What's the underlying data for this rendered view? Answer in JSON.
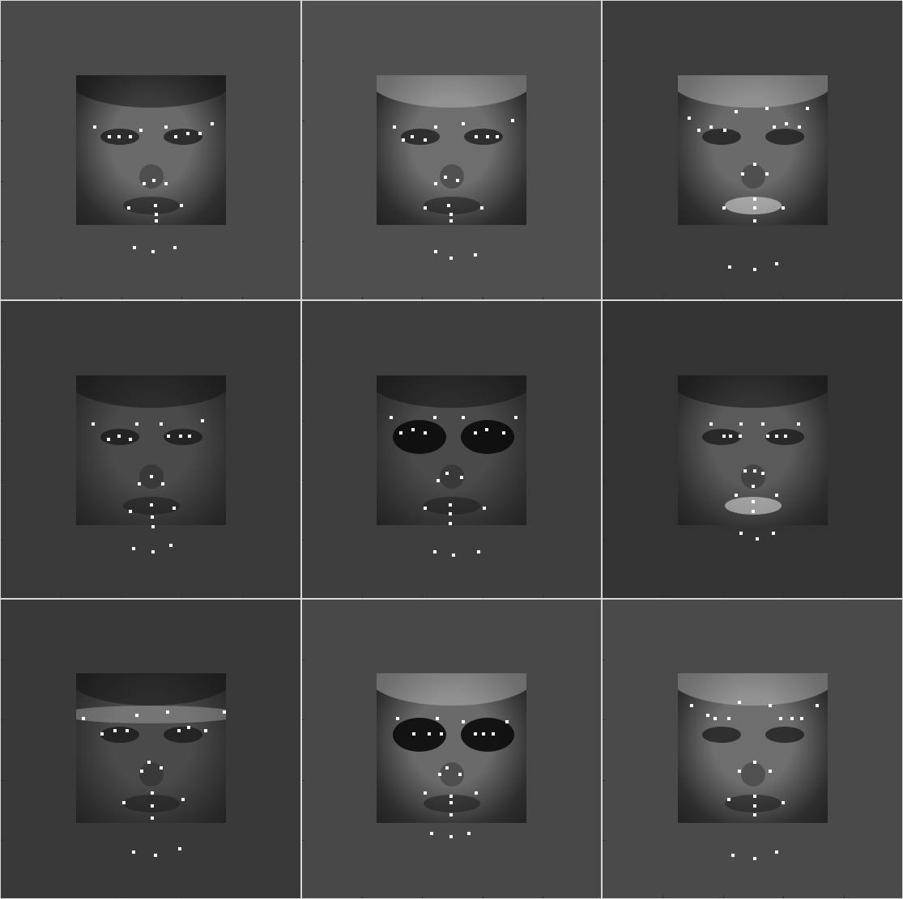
{
  "grid": {
    "rows": 3,
    "cols": 3,
    "panels": [
      {
        "background": "#4a4a4a",
        "subject": "man-short-hair",
        "face_tone": "#6a6a6a",
        "eyewear": "none",
        "landmark_count": 20
      },
      {
        "background": "#4f4f4f",
        "subject": "woman-blonde",
        "face_tone": "#6e6e6e",
        "eyewear": "none",
        "landmark_count": 20
      },
      {
        "background": "#3c3c3c",
        "subject": "woman-blonde-smiling",
        "face_tone": "#6a6a6a",
        "eyewear": "none",
        "landmark_count": 20
      },
      {
        "background": "#3a3a3a",
        "subject": "man-dark-skin",
        "face_tone": "#4a4a4a",
        "eyewear": "none",
        "landmark_count": 20
      },
      {
        "background": "#3e3e3e",
        "subject": "man-sunglasses",
        "face_tone": "#4a4a4a",
        "eyewear": "sunglasses",
        "landmark_count": 20
      },
      {
        "background": "#333333",
        "subject": "woman-curly-hair-earrings",
        "face_tone": "#5a5a5a",
        "eyewear": "none",
        "landmark_count": 20
      },
      {
        "background": "#393939",
        "subject": "person-headband",
        "face_tone": "#4a4a4a",
        "eyewear": "none",
        "landmark_count": 20
      },
      {
        "background": "#484848",
        "subject": "woman-sunglasses",
        "face_tone": "#6a6a6a",
        "eyewear": "sunglasses",
        "landmark_count": 20
      },
      {
        "background": "#4a4a4a",
        "subject": "woman-tilted-head",
        "face_tone": "#6e6e6e",
        "eyewear": "none",
        "landmark_count": 20
      }
    ],
    "landmark_color": "#ffffff"
  }
}
